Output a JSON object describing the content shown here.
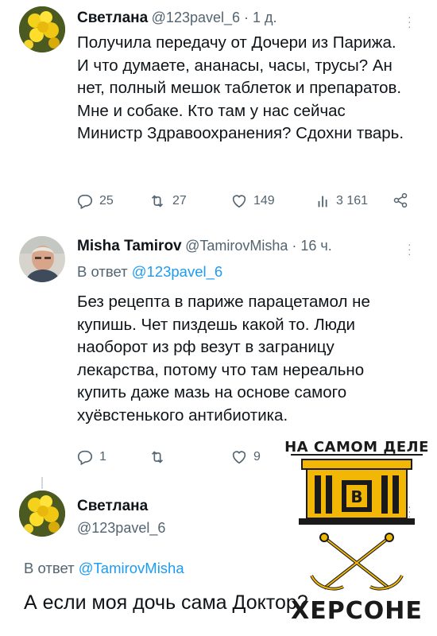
{
  "tweet1": {
    "author_name": "Светлана",
    "handle_time": "@123pavel_6 · 1 д.",
    "text": "Получила передачу от Дочери из Парижа. И что думаете, ананасы, часы, трусы? Ан нет, полный мешок таблеток и препаратов. Мне и собаке. Кто там у нас сейчас Министр Здравоохранения? Сдохни тварь.",
    "actions": {
      "replies": "25",
      "retweets": "27",
      "likes": "149",
      "views": "3 161"
    }
  },
  "tweet2": {
    "author_name": "Misha Tamirov",
    "handle_time": "@TamirovMisha · 16 ч.",
    "reply_prefix": "В ответ ",
    "reply_handle": "@123pavel_6",
    "text": "Без рецепта в париже парацетамол не купишь. Чет пиздешь какой то. Люди наоборот из рф везут в заграницу лекарства, потому что там нереально купить даже мазь на основе самого хуёвстенького антибиотика.",
    "actions": {
      "replies": "1",
      "retweets": "",
      "likes": "9"
    }
  },
  "tweet3": {
    "author_name": "Светлана",
    "handle": "@123pavel_6",
    "reply_prefix": "В ответ ",
    "reply_handle": "@TamirovMisha",
    "text": "А если моя дочь сама Доктор?"
  },
  "watermark": {
    "top_text": "НА САМОМ ДЕЛЕ",
    "badge_letter": "В",
    "bottom_text": "ХЕРСОНЕ"
  },
  "colors": {
    "link": "#1d9bf0",
    "muted": "#536471",
    "watermark": "#f2b705"
  }
}
